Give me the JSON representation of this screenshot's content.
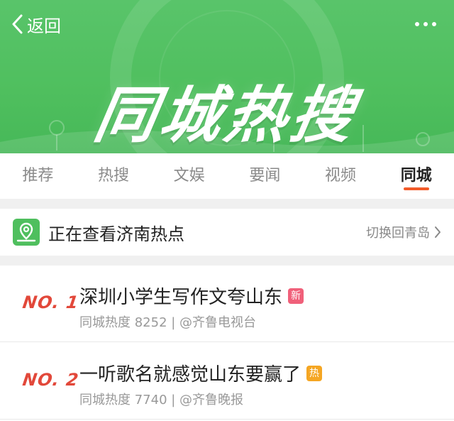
{
  "header": {
    "back_label": "返回",
    "banner_title": "同城热搜",
    "accent_color": "#4fbf5e"
  },
  "tabs": [
    {
      "label": "推荐",
      "active": false
    },
    {
      "label": "热搜",
      "active": false
    },
    {
      "label": "文娱",
      "active": false
    },
    {
      "label": "要闻",
      "active": false
    },
    {
      "label": "视频",
      "active": false
    },
    {
      "label": "同城",
      "active": true
    }
  ],
  "location": {
    "icon": "location-pin-icon",
    "text": "正在查看济南热点",
    "switch_label": "切换回青岛"
  },
  "hot_list": [
    {
      "rank": "NO. 1",
      "title": "深圳小学生写作文夸山东",
      "badge": "新",
      "badge_color": "#f0607a",
      "meta": "同城热度 8252 | @齐鲁电视台"
    },
    {
      "rank": "NO. 2",
      "title": "一听歌名就感觉山东要赢了",
      "badge": "热",
      "badge_color": "#f5a623",
      "meta": "同城热度 7740 | @齐鲁晚报"
    }
  ]
}
